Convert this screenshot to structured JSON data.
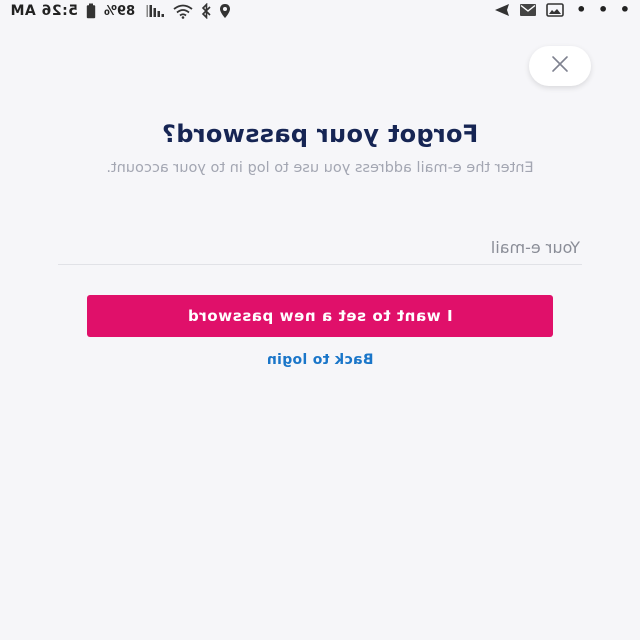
{
  "status_bar": {
    "time": "5:26 AM",
    "battery_percent": "89%",
    "overflow_dots": "• • •",
    "icons": [
      "battery-icon",
      "signal-icon",
      "wifi-icon",
      "bluetooth-icon",
      "location-icon",
      "mail-icon",
      "photo-icon",
      "send-icon"
    ]
  },
  "header": {
    "close_icon": "close-icon"
  },
  "main": {
    "title": "Forgot your password?",
    "subtitle": "Enter the e-mail address you use to log in to your account.",
    "email_placeholder": "Your e-mail",
    "email_value": "",
    "submit_label": "I want to set a new password",
    "back_label": "Back to login"
  },
  "colors": {
    "background": "#f6f6f9",
    "title": "#162554",
    "subtitle": "#a3a6b2",
    "primary_button": "#e0106a",
    "link": "#1a76c9"
  }
}
